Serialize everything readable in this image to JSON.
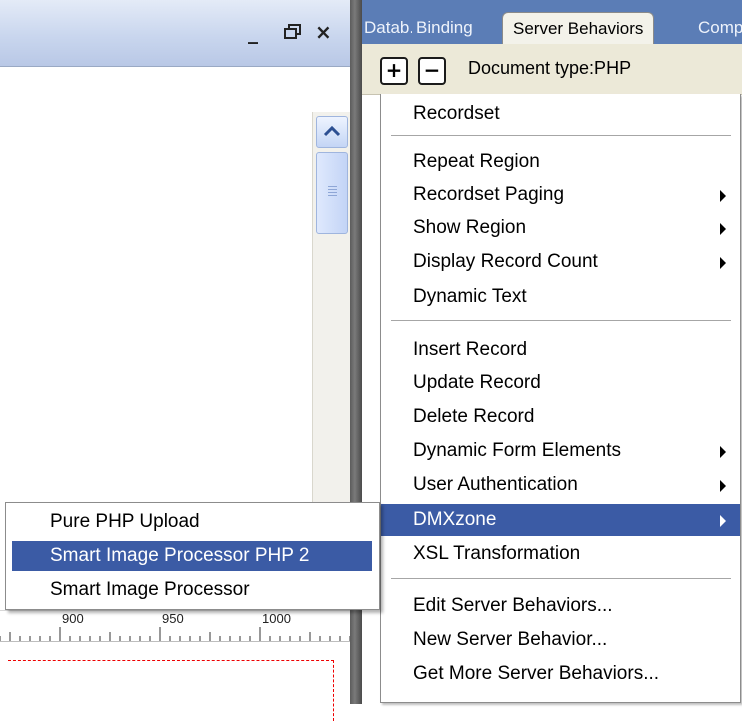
{
  "document_window": {
    "controls": {
      "minimize": "_",
      "restore": "🗗",
      "close": "×"
    },
    "ruler_labels": [
      "900",
      "950",
      "1000"
    ]
  },
  "panel": {
    "tabs": [
      "Datab.",
      "Binding",
      "Server Behaviors",
      "Comp"
    ],
    "toolbar": {
      "add": "+",
      "remove": "−",
      "document_type": "Document type:PHP"
    }
  },
  "menu": {
    "items": [
      "Recordset",
      "Repeat Region",
      "Recordset Paging",
      "Show Region",
      "Display Record Count",
      "Dynamic Text",
      "Insert Record",
      "Update Record",
      "Delete Record",
      "Dynamic Form Elements",
      "User Authentication",
      "DMXzone",
      "XSL Transformation",
      "Edit Server Behaviors...",
      "New Server Behavior...",
      "Get More Server Behaviors..."
    ],
    "highlighted": "DMXzone"
  },
  "submenu": {
    "items": [
      "Pure PHP Upload",
      "Smart Image Processor PHP 2",
      "Smart Image Processor"
    ],
    "highlighted": "Smart Image Processor PHP 2"
  },
  "colors": {
    "highlight": "#3b5ba5",
    "panel_tab_bar": "#5b7db6",
    "titlebar": "#c9d6ee"
  }
}
